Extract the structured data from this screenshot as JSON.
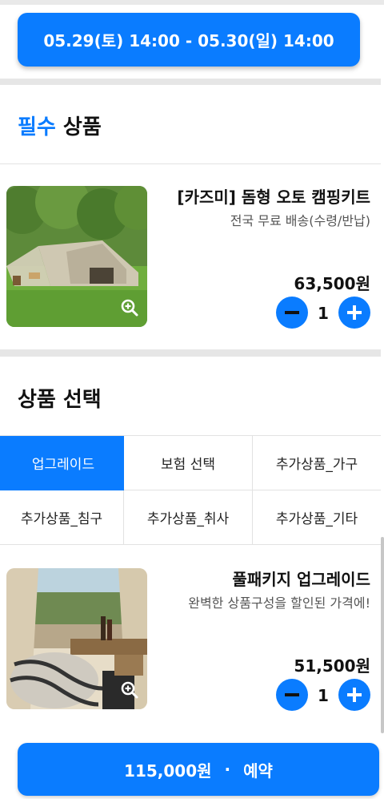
{
  "date_range": "05.29(토) 14:00 - 05.30(일) 14:00",
  "required_section": {
    "title_accent": "필수",
    "title_rest": " 상품"
  },
  "required_product": {
    "name": "[카즈미] 돔형 오토 캠핑키트",
    "subtitle": "전국 무료 배송(수령/반납)",
    "price": "63,500원",
    "quantity": "1",
    "image_icon": "zoom-in-icon"
  },
  "selection_section": {
    "title": "상품 선택"
  },
  "tabs": [
    {
      "label": "업그레이드",
      "active": true
    },
    {
      "label": "보험 선택",
      "active": false
    },
    {
      "label": "추가상품_가구",
      "active": false
    },
    {
      "label": "추가상품_침구",
      "active": false
    },
    {
      "label": "추가상품_취사",
      "active": false
    },
    {
      "label": "추가상품_기타",
      "active": false
    }
  ],
  "upgrade_product": {
    "name": "풀패키지 업그레이드",
    "subtitle": "완벽한 상품구성을 할인된 가격에!",
    "price": "51,500원",
    "quantity": "1",
    "image_icon": "zoom-in-icon"
  },
  "booking": {
    "total": "115,000원",
    "separator": "·",
    "action": "예약"
  },
  "colors": {
    "accent": "#0a7cff",
    "divider": "#e6e6e6"
  }
}
